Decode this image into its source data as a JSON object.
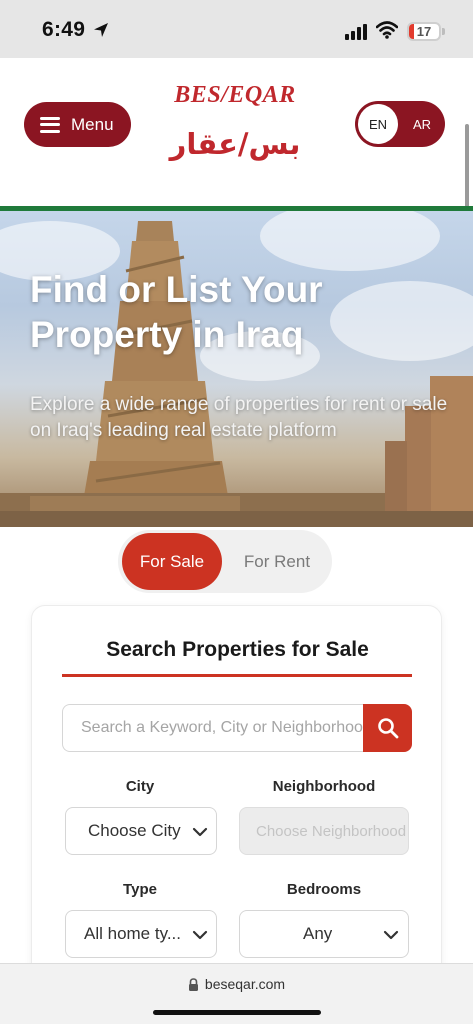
{
  "status_bar": {
    "time": "6:49",
    "battery_level": "17",
    "battery_fraction": 0.17
  },
  "header": {
    "menu_label": "Menu",
    "logo_en": "BES/EQAR",
    "logo_ar": "بس/عقار",
    "lang_en": "EN",
    "lang_ar": "AR",
    "stripe_color": "#1f7a3a",
    "brand_color": "#8b1522"
  },
  "hero": {
    "title": "Find or List Your Property in Iraq",
    "subtitle": "Explore a wide range of properties for rent or sale on Iraq's leading real estate platform"
  },
  "mode_toggle": {
    "sale_label": "For Sale",
    "rent_label": "For Rent",
    "active": "For Sale",
    "accent_color": "#cc3322"
  },
  "search": {
    "heading": "Search Properties for Sale",
    "placeholder": "Search a Keyword, City or Neighborhood",
    "city_label": "City",
    "city_value": "Choose City",
    "neighborhood_label": "Neighborhood",
    "neighborhood_value": "Choose Neighborhood",
    "type_label": "Type",
    "type_value": "All home ty...",
    "bedrooms_label": "Bedrooms",
    "bedrooms_value": "Any"
  },
  "browser": {
    "url": "beseqar.com"
  }
}
